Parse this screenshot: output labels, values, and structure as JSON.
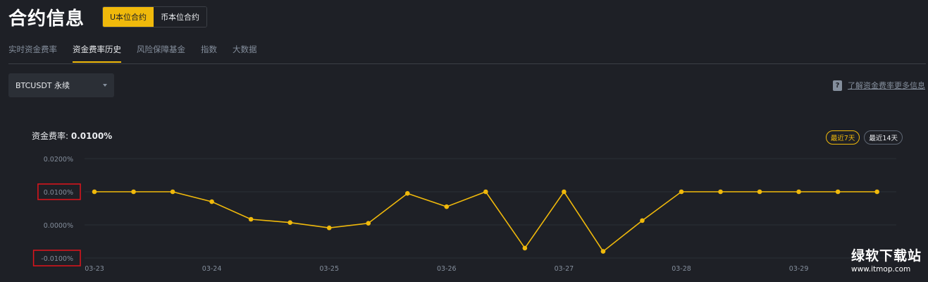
{
  "header": {
    "title": "合约信息",
    "contract_types": [
      "U本位合约",
      "币本位合约"
    ]
  },
  "tabs": [
    "实时资金费率",
    "资金费率历史",
    "风险保障基金",
    "指数",
    "大数据"
  ],
  "symbol_select": {
    "value": "BTCUSDT 永续"
  },
  "more_info_link": "了解资金费率更多信息",
  "help_icon_glyph": "?",
  "funding_rate": {
    "label": "资金费率: ",
    "value": "0.0100%"
  },
  "range_options": [
    "最近7天",
    "最近14天"
  ],
  "colors": {
    "accent": "#f0b90b",
    "background": "#1e2026",
    "grid": "#2b2f36",
    "highlight_box": "#e0141c"
  },
  "chart_data": {
    "type": "line",
    "title": "",
    "xlabel": "",
    "ylabel": "",
    "ylim": [
      -0.0001,
      0.0002
    ],
    "ytick_values": [
      0.0002,
      0.0001,
      0.0,
      -0.0001
    ],
    "ytick_labels": [
      "0.0200%",
      "0.0100%",
      "0.0000%",
      "-0.0100%"
    ],
    "xtick_labels": [
      "03-23",
      "03-24",
      "03-25",
      "03-26",
      "03-27",
      "03-28",
      "03-29"
    ],
    "x_points_per_day": 3,
    "grid": true,
    "highlighted_ticks": [
      "0.0100%",
      "-0.0100%"
    ],
    "series": [
      {
        "values": [
          0.0001,
          0.0001,
          0.0001,
          7e-05,
          1.7e-05,
          7e-06,
          -9e-06,
          5e-06,
          9.5e-05,
          5.5e-05,
          0.0001,
          -7e-05,
          0.0001,
          -8e-05,
          1.3e-05,
          0.0001,
          0.0001,
          0.0001,
          0.0001,
          0.0001,
          0.0001
        ]
      }
    ]
  },
  "watermark": {
    "cn": "绿软下载站",
    "url": "www.itmop.com"
  }
}
